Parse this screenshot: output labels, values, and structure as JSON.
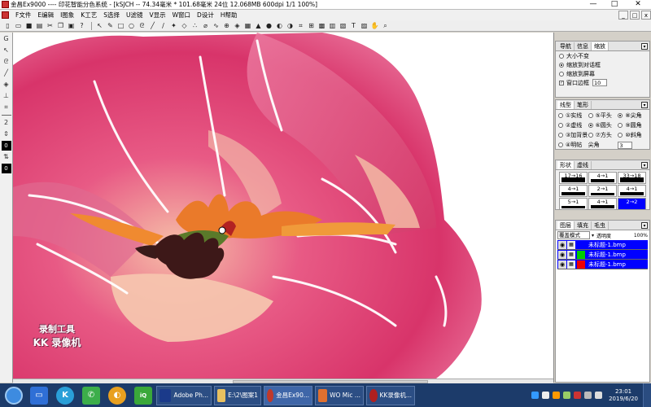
{
  "window": {
    "title": "金昌Ex9000 ---- 印花智能分色系统 - [kSJCH -- 74.34毫米 * 101.68毫米 24位  12.068MB 600dpi 1/1    100%]",
    "minimize": "—",
    "maximize": "□",
    "close": "✕"
  },
  "menu": {
    "items": [
      "F文件",
      "E编辑",
      "I图象",
      "K工艺",
      "S选择",
      "U滤镜",
      "V显示",
      "W窗口",
      "D设计",
      "H帮助"
    ],
    "mdi_min": "_",
    "mdi_max": "□",
    "mdi_close": "x"
  },
  "left_tools": {
    "size_value": "2",
    "color_top": "0",
    "color_bottom": "0",
    "tool_g": "G"
  },
  "canvas": {
    "watermark_line1": "录制工具",
    "watermark_line2": "KK 录像机"
  },
  "panel_nav": {
    "tabs": [
      "导航",
      "信息",
      "缩放"
    ],
    "options": [
      "大小不变",
      "缩放到对话框",
      "缩放到屏幕"
    ],
    "selected_option": 1,
    "window_border_label": "窗口边框",
    "window_border_value": "10"
  },
  "panel_line": {
    "tabs": [
      "线型",
      "笔形"
    ],
    "options": [
      "①实线",
      "②平头",
      "③虚线",
      "④圆头",
      "⑤加背景",
      "⑥方头",
      "⑦明帖",
      "⑧尖角"
    ],
    "right_options": [
      "⑨尖角",
      "⑩圆角",
      "⑪斜角"
    ],
    "sharp_label": "尖角",
    "sharp_value": "3",
    "col1": [
      "①实线",
      "②虚线",
      "③加背景",
      "④明帖"
    ],
    "col2": [
      "⑤平头",
      "⑥圆头",
      "⑦方头"
    ],
    "col3": [
      "⑧尖角",
      "⑨圆角",
      "⑩斜角"
    ],
    "selected": "⑥圆头"
  },
  "panel_shape": {
    "tabs": [
      "形状",
      "虚线"
    ],
    "cells": [
      "17→16",
      "4→1",
      "33→18",
      "4→1",
      "2→1",
      "4→1",
      "5→1",
      "4→1",
      "2→2"
    ]
  },
  "panel_layers": {
    "tabs": [
      "图层",
      "填充",
      "毛虫"
    ],
    "blend_mode": "覆盖模式",
    "opacity_label": "透明度",
    "opacity_value": "100%",
    "layers": [
      {
        "name": "未标题-1.bmp",
        "color": "#0000ff"
      },
      {
        "name": "未标题-1.bmp",
        "color": "#00cc00"
      },
      {
        "name": "未标题-1.bmp",
        "color": "#ee0000"
      }
    ]
  },
  "taskbar": {
    "tasks": [
      {
        "label": "Adobe Ph...",
        "color": "#1b3a8a"
      },
      {
        "label": "E:\\2\\图案1",
        "color": "#e8c060"
      },
      {
        "label": "金昌Ex90...",
        "color": "#c0392b"
      },
      {
        "label": "WO Mic ...",
        "color": "#e07030"
      },
      {
        "label": "KK录像机...",
        "color": "#b02020"
      }
    ],
    "time": "23:01",
    "date": "2019/6/20"
  }
}
